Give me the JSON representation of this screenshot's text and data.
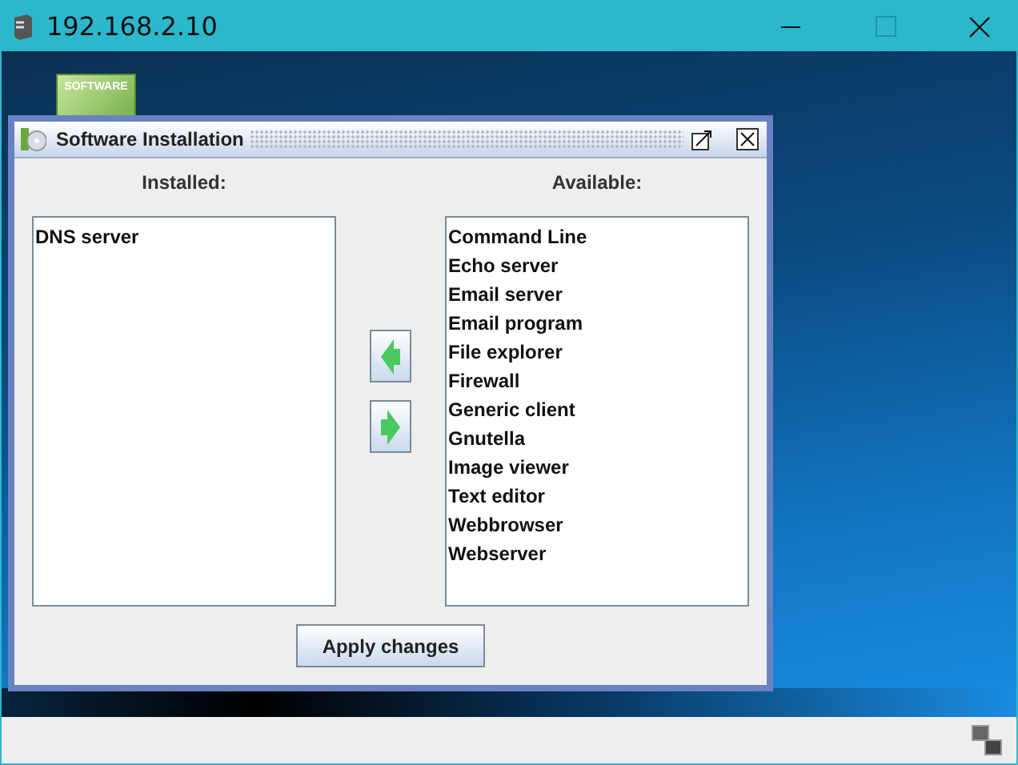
{
  "window": {
    "title": "192.168.2.10"
  },
  "desktop_icon": {
    "label": "SOFTWARE"
  },
  "dialog": {
    "title": "Software Installation",
    "installed": {
      "label": "Installed:",
      "items": [
        "DNS server"
      ]
    },
    "available": {
      "label": "Available:",
      "items": [
        "Command Line",
        "Echo server",
        "Email server",
        "Email program",
        "File explorer",
        "Firewall",
        "Generic client",
        "Gnutella",
        "Image viewer",
        "Text editor",
        "Webbrowser",
        "Webserver"
      ]
    },
    "apply_button": "Apply changes"
  }
}
